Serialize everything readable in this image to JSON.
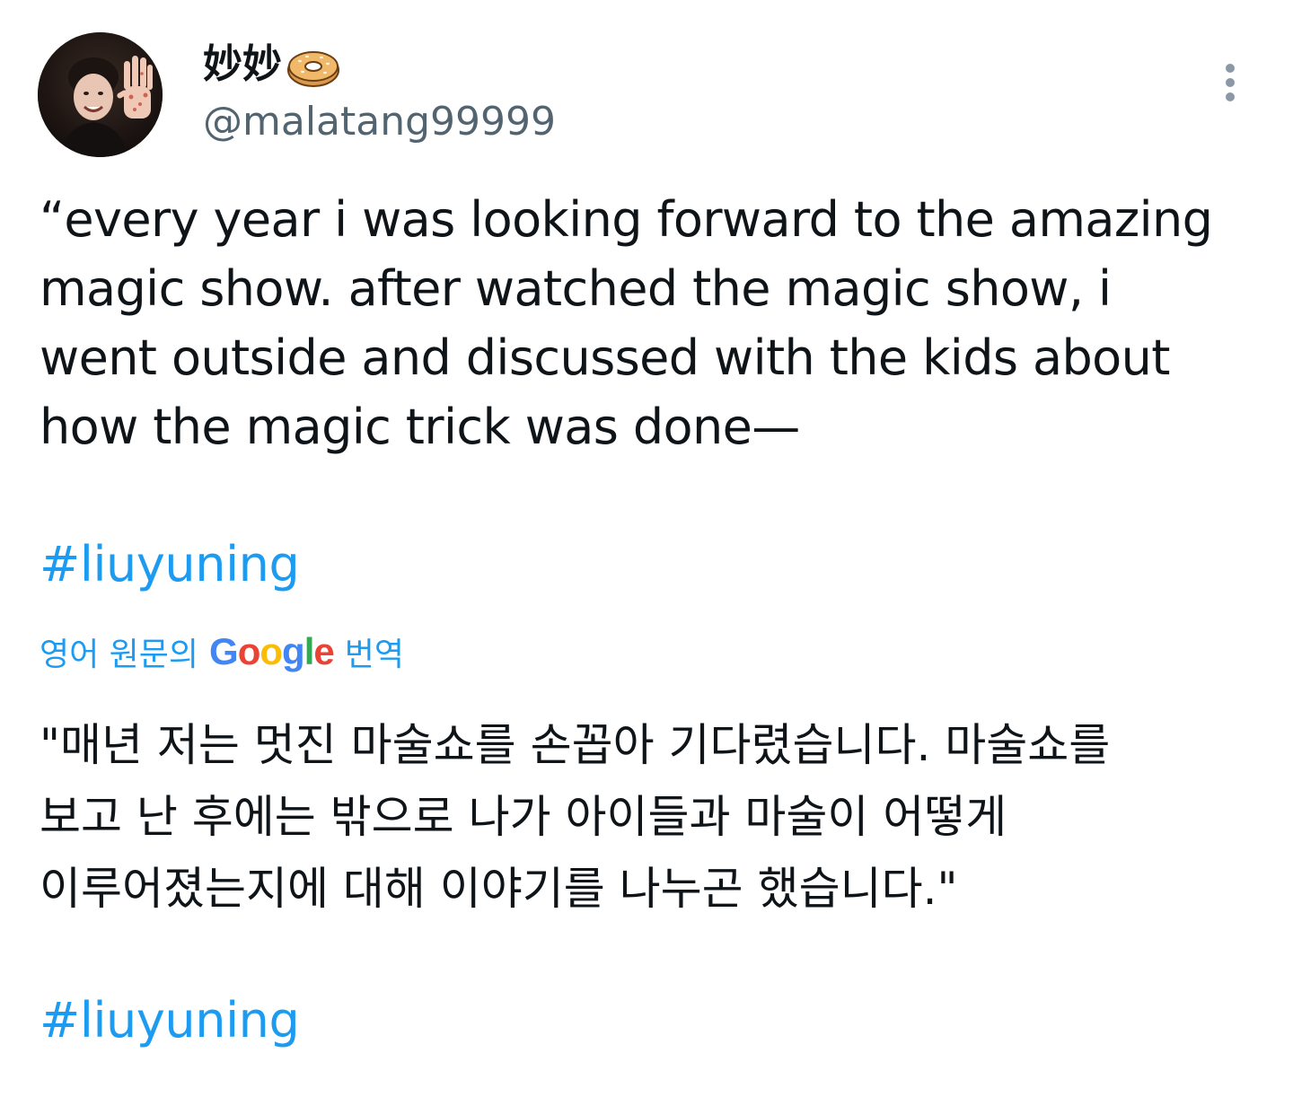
{
  "author": {
    "display_name": "妙妙",
    "name_emoji_icon": "bagel-icon",
    "handle": "@malatang99999",
    "avatar_icon": "profile-avatar"
  },
  "tweet": {
    "text": "“every year i was looking forward to the amazing\nmagic show. after watched the magic show, i\nwent outside and discussed with the kids about\nhow the magic trick was done—",
    "hashtag": "#liuyuning"
  },
  "translation": {
    "prefix": "영어 원문의",
    "provider": "Google",
    "suffix": "번역",
    "text": "\"매년 저는 멋진 마술쇼를 손꼽아 기다렸습니다. 마술쇼를\n보고 난 후에는 밖으로 나가 아이들과 마술이 어떻게\n이루어졌는지에 대해 이야기를 나누곤 했습니다.\"",
    "hashtag": "#liuyuning"
  },
  "menu": {
    "icon": "more-vertical-icon"
  },
  "colors": {
    "link": "#1d9bf0",
    "text": "#0f1419",
    "secondary": "#536471"
  }
}
